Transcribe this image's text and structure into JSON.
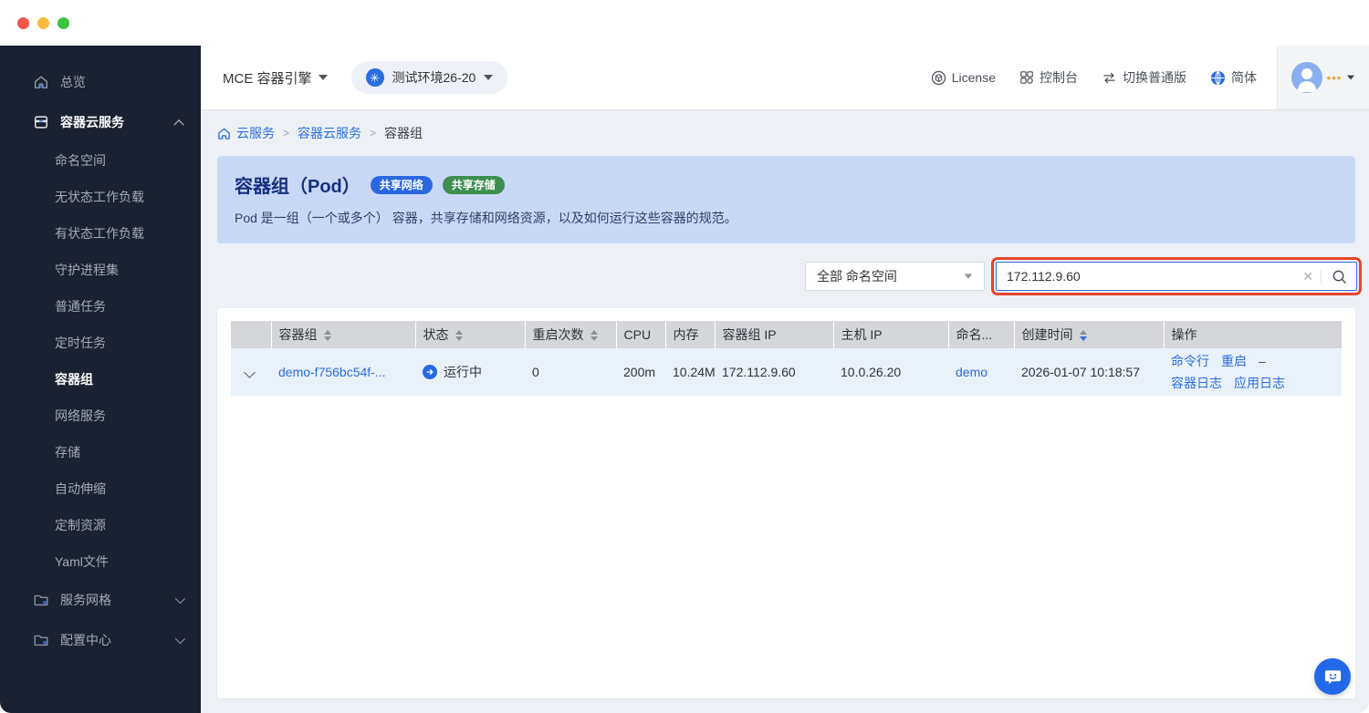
{
  "topbar": {
    "product": "MCE 容器引擎",
    "environment": "测试环境26-20",
    "license_label": "License",
    "console_label": "控制台",
    "switch_label": "切换普通版",
    "language_label": "简体"
  },
  "sidebar": {
    "overview": "总览",
    "container_cloud": {
      "label": "容器云服务",
      "children": [
        "命名空间",
        "无状态工作负载",
        "有状态工作负载",
        "守护进程集",
        "普通任务",
        "定时任务",
        "容器组",
        "网络服务",
        "存储",
        "自动伸缩",
        "定制资源",
        "Yaml文件"
      ],
      "active_child": "容器组"
    },
    "service_mesh": "服务网格",
    "config_center": "配置中心"
  },
  "breadcrumb": {
    "items": [
      "云服务",
      "容器云服务",
      "容器组"
    ]
  },
  "banner": {
    "title": "容器组（Pod）",
    "badges": [
      {
        "label": "共享网络",
        "color": "#2b68e0"
      },
      {
        "label": "共享存储",
        "color": "#3d8e50"
      }
    ],
    "description": "Pod 是一组（一个或多个） 容器，共享存储和网络资源，以及如何运行这些容器的规范。"
  },
  "toolbar": {
    "namespace_select": "全部 命名空间",
    "search_value": "172.112.9.60"
  },
  "table": {
    "columns": [
      {
        "label": "容器组"
      },
      {
        "label": "状态"
      },
      {
        "label": "重启次数"
      },
      {
        "label": "CPU"
      },
      {
        "label": "内存"
      },
      {
        "label": "容器组 IP"
      },
      {
        "label": "主机 IP"
      },
      {
        "label": "命名..."
      },
      {
        "label": "创建时间"
      },
      {
        "label": "操作"
      }
    ],
    "row": {
      "name": "demo-f756bc54f-...",
      "status": "运行中",
      "restarts": "0",
      "cpu": "200m",
      "memory": "10.24M",
      "pod_ip": "172.112.9.60",
      "host_ip": "10.0.26.20",
      "namespace": "demo",
      "created": "2026-01-07 10:18:57",
      "actions": {
        "a0": "命令行",
        "a1": "重启",
        "dash": "–",
        "a2": "容器日志",
        "a3": "应用日志"
      }
    }
  },
  "colors": {
    "accent": "#2b6de0",
    "annotation": "#e4472c",
    "status_running": "#2468e4"
  }
}
